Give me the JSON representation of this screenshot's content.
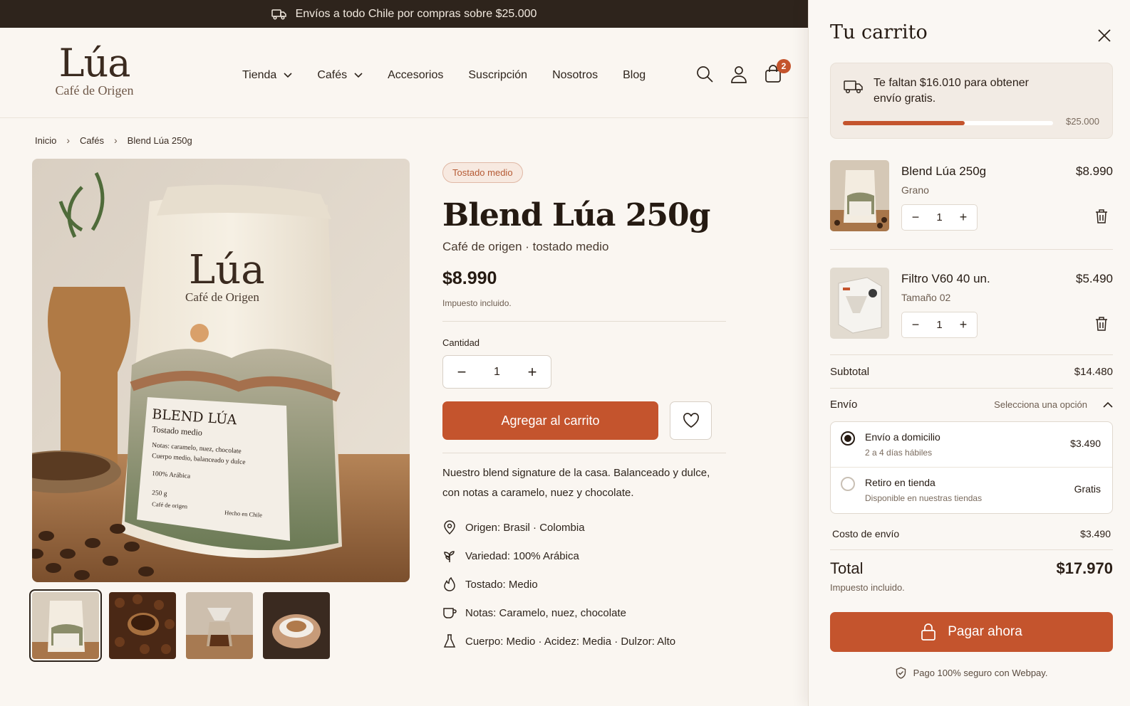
{
  "topbar": {
    "text": "Envíos a todo Chile por compras sobre $25.000",
    "icon": "truck-icon"
  },
  "logo": {
    "name": "Lúa",
    "tagline": "Café de Origen"
  },
  "nav": {
    "items": [
      {
        "label": "Tienda",
        "has_dropdown": true
      },
      {
        "label": "Cafés",
        "has_dropdown": true
      },
      {
        "label": "Accesorios",
        "has_dropdown": false
      },
      {
        "label": "Suscripción",
        "has_dropdown": false
      },
      {
        "label": "Nosotros",
        "has_dropdown": false
      },
      {
        "label": "Blog",
        "has_dropdown": false
      }
    ],
    "cart_count": "2"
  },
  "breadcrumb": {
    "items": [
      "Inicio",
      "Cafés",
      "Blend Lúa 250g"
    ],
    "separator": "›"
  },
  "product": {
    "badge": "Tostado medio",
    "title": "Blend Lúa 250g",
    "subtitle": "Café de origen · tostado medio",
    "price": "$8.990",
    "tax_note": "Impuesto incluido.",
    "quantity_label": "Cantidad",
    "quantity": "1",
    "add_to_cart": "Agregar al carrito",
    "description": "Nuestro blend signature de la casa. Balanceado y dulce, con notas a caramelo, nuez y chocolate.",
    "attributes": [
      {
        "icon": "map-pin-icon",
        "text": "Origen: Brasil · Colombia"
      },
      {
        "icon": "plant-icon",
        "text": "Variedad: 100% Arábica"
      },
      {
        "icon": "flame-icon",
        "text": "Tostado: Medio"
      },
      {
        "icon": "cup-icon",
        "text": "Notas: Caramelo, nuez, chocolate"
      },
      {
        "icon": "flask-icon",
        "text": "Cuerpo: Medio · Acidez: Media · Dulzor: Alto"
      }
    ],
    "bag": {
      "brand": "Lúa",
      "brand_sub": "Café de Origen",
      "label_title": "BLEND LÚA",
      "label_roast": "Tostado medio",
      "label_notes": "Notas: caramelo, nuez, chocolate",
      "label_body": "Cuerpo medio, balanceado y dulce",
      "label_arabica": "100% Arábica",
      "label_weight": "250 g",
      "label_origin": "Café de origen",
      "label_made": "Hecho en Chile"
    },
    "thumbnails": [
      "bag",
      "beans-scoop",
      "pour-over",
      "cup-in-hands"
    ]
  },
  "cart": {
    "title": "Tu carrito",
    "free_shipping_msg": "Te faltan $16.010 para obtener envío gratis.",
    "free_shipping_goal": "$25.000",
    "free_shipping_progress": 0.58,
    "items": [
      {
        "name": "Blend Lúa 250g",
        "variant": "Grano",
        "price": "$8.990",
        "qty": "1"
      },
      {
        "name": "Filtro V60 40 un.",
        "variant": "Tamaño 02",
        "price": "$5.490",
        "qty": "1"
      }
    ],
    "subtotal_label": "Subtotal",
    "subtotal": "$14.480",
    "shipping_label": "Envío",
    "shipping_select_hint": "Selecciona una opción",
    "shipping_options": [
      {
        "title": "Envío a domicilio",
        "subtitle": "2 a 4 días hábiles",
        "price": "$3.490",
        "selected": true
      },
      {
        "title": "Retiro en tienda",
        "subtitle": "Disponible en nuestras tiendas",
        "price": "Gratis",
        "selected": false
      }
    ],
    "shipping_cost_label": "Costo de envío",
    "shipping_cost": "$3.490",
    "total_label": "Total",
    "total": "$17.970",
    "total_tax_note": "Impuesto incluido.",
    "pay_button": "Pagar ahora",
    "secure_note": "Pago 100% seguro con Webpay."
  },
  "colors": {
    "accent": "#c4542d",
    "dark": "#2e241c",
    "background": "#faf6f1"
  }
}
